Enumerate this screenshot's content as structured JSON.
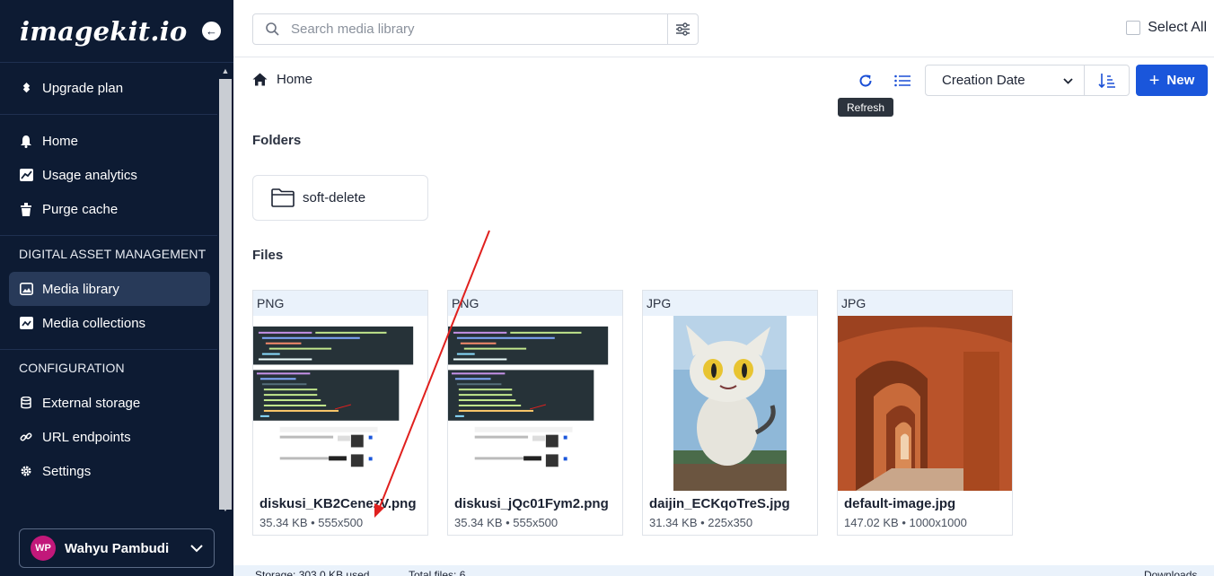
{
  "sidebar": {
    "logo": "imagekit.io",
    "upgrade": "Upgrade plan",
    "items": [
      {
        "label": "Home"
      },
      {
        "label": "Usage analytics"
      },
      {
        "label": "Purge cache"
      }
    ],
    "dam_heading": "DIGITAL ASSET MANAGEMENT",
    "dam_items": [
      {
        "label": "Media library"
      },
      {
        "label": "Media collections"
      }
    ],
    "config_heading": "CONFIGURATION",
    "config_items": [
      {
        "label": "External storage"
      },
      {
        "label": "URL endpoints"
      },
      {
        "label": "Settings"
      }
    ],
    "user": {
      "initials": "WP",
      "name": "Wahyu Pambudi"
    }
  },
  "search": {
    "placeholder": "Search media library"
  },
  "select_all": "Select All",
  "breadcrumb": "Home",
  "sort": {
    "selected": "Creation Date"
  },
  "new_label": "New",
  "tooltip": "Refresh",
  "folders_title": "Folders",
  "folders": [
    {
      "name": "soft-delete"
    }
  ],
  "files_title": "Files",
  "files": [
    {
      "type": "PNG",
      "name": "diskusi_KB2CenezV.png",
      "meta": "35.34 KB • 555x500"
    },
    {
      "type": "PNG",
      "name": "diskusi_jQc01Fym2.png",
      "meta": "35.34 KB • 555x500"
    },
    {
      "type": "JPG",
      "name": "daijin_ECKqoTreS.jpg",
      "meta": "31.34 KB • 225x350"
    },
    {
      "type": "JPG",
      "name": "default-image.jpg",
      "meta": "147.02 KB • 1000x1000"
    }
  ],
  "footer": {
    "storage": "Storage: 303.0 KB used",
    "total": "Total files: 6",
    "downloads": "Downloads"
  },
  "colors": {
    "sidebar_bg": "#0d1b33",
    "accent": "#1a56db",
    "annotation": "#e0201e"
  }
}
